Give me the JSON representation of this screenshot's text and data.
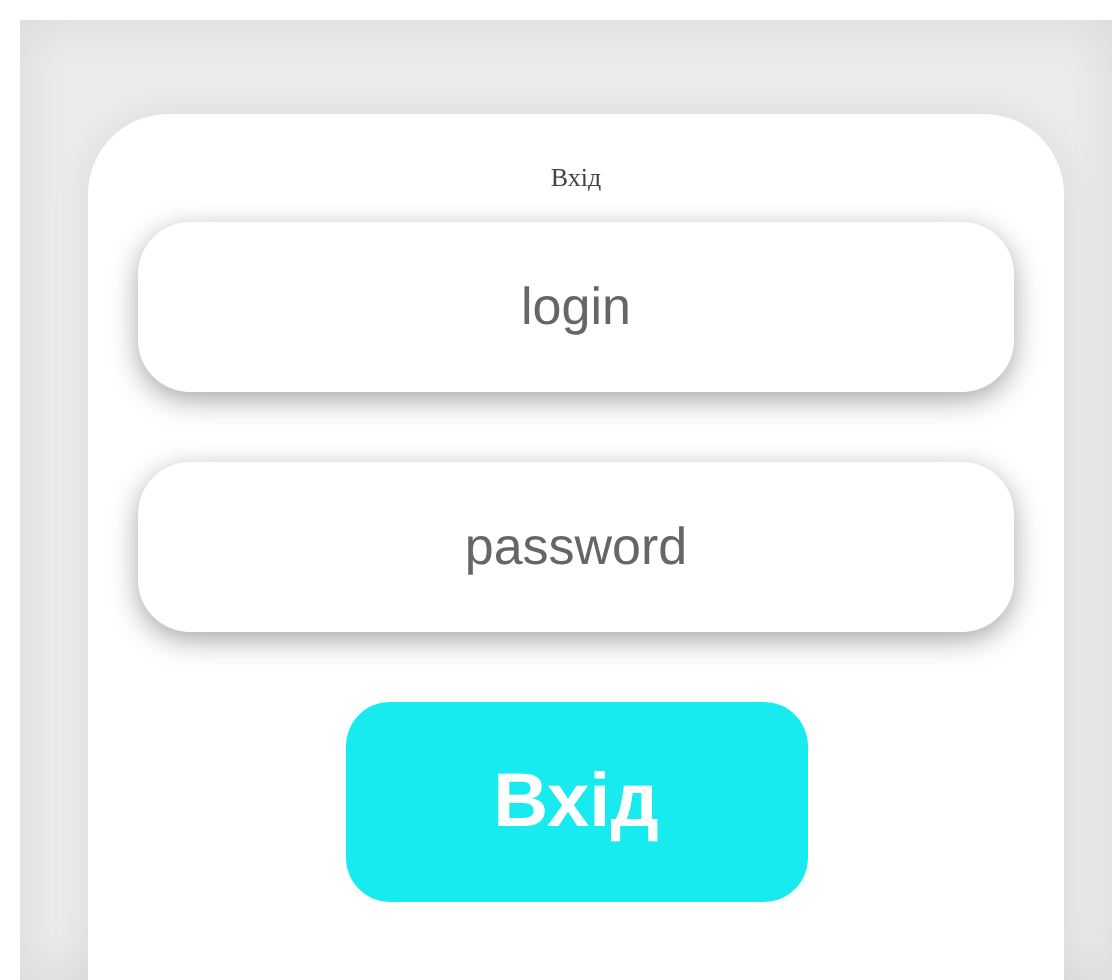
{
  "form": {
    "title": "Вхід",
    "fields": [
      {
        "placeholder": "login"
      },
      {
        "placeholder": "password"
      }
    ],
    "submit": {
      "label": "Вхід"
    }
  }
}
